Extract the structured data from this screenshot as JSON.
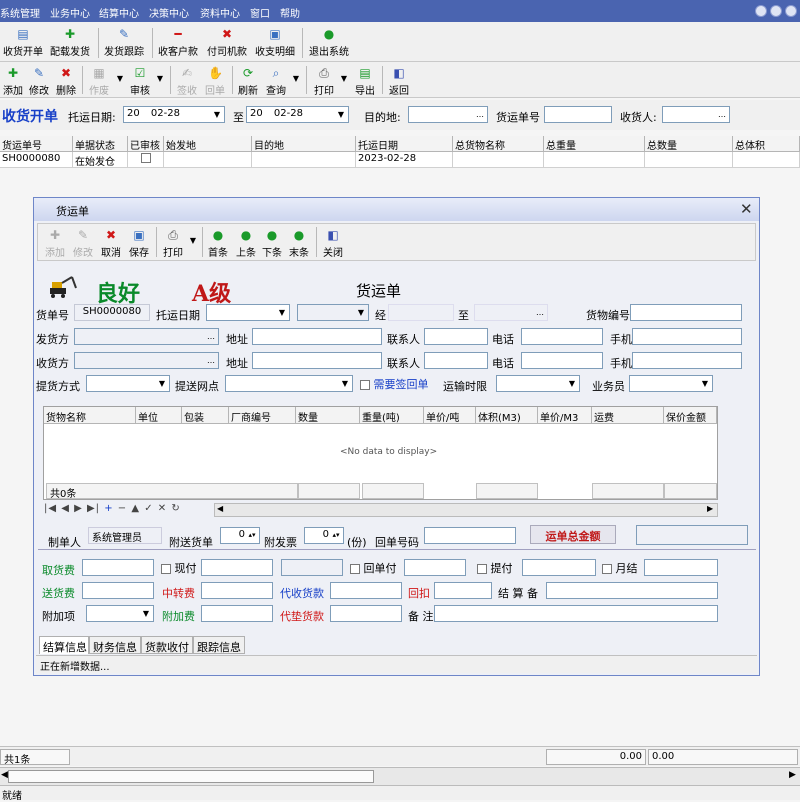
{
  "menu": {
    "items": [
      "系统管理",
      "业务中心",
      "结算中心",
      "决策中心",
      "资料中心",
      "窗口",
      "帮助"
    ]
  },
  "toolbar1": {
    "buttons": [
      "收货开单",
      "配载发货",
      "发货跟踪",
      "收客户款",
      "付司机款",
      "收支明细",
      "退出系统"
    ]
  },
  "toolbar2": {
    "buttons": [
      "添加",
      "修改",
      "删除",
      "作废",
      "审核",
      "签收",
      "回单",
      "刷新",
      "查询",
      "打印",
      "导出",
      "返回"
    ]
  },
  "filter": {
    "title": "收货开单",
    "date_label": "托运日期:",
    "date_from": "20",
    "date_from_rest": "02-28",
    "to_label": "至",
    "date_to": "20",
    "date_to_rest": "02-28",
    "dest_label": "目的地:",
    "dest_value": "",
    "waybill_label": "货运单号",
    "waybill_value": "",
    "receiver_label": "收货人:",
    "receiver_value": ""
  },
  "grid": {
    "headers": [
      "货运单号",
      "单据状态",
      "已审核",
      "始发地",
      "目的地",
      "托运日期",
      "总货物名称",
      "总重量",
      "总数量",
      "总体积"
    ],
    "rows": [
      {
        "waybill": "SH0000080",
        "status": "在始发仓",
        "origin": "",
        "dest": "",
        "date": "2023-02-28",
        "goods": "",
        "weight": "",
        "qty": "",
        "volume": ""
      }
    ]
  },
  "dialog": {
    "title": "货运单",
    "toolbar": [
      "添加",
      "修改",
      "取消",
      "保存",
      "打印",
      "首条",
      "上条",
      "下条",
      "末条",
      "关闭"
    ],
    "badge_good": "良好",
    "badge_level": "A级",
    "form_title": "货运单",
    "waybill_label": "货单号",
    "waybill_value": "SH0000080",
    "date_label": "托运日期",
    "date_value": "",
    "via_label": "经",
    "to_label": "至",
    "goods_no_label": "货物编号",
    "sender_label": "发货方",
    "addr_label": "地址",
    "contact_label": "联系人",
    "phone_label": "电话",
    "mobile_label": "手机",
    "receiver_label": "收货方",
    "pickup_label": "提货方式",
    "delivery_point_label": "提送网点",
    "need_receipt_label": "需要签回单",
    "transport_limit_label": "运输时限",
    "salesman_label": "业务员",
    "goods_grid": {
      "headers": [
        "货物名称",
        "单位",
        "包装",
        "厂商编号",
        "数量",
        "重量(吨)",
        "单价/吨",
        "体积(M3)",
        "单价/M3",
        "运费",
        "保价金额"
      ],
      "empty_text": "<No data to display>",
      "footer_count": "共0条"
    },
    "maker_label": "制单人",
    "maker_value": "系统管理员",
    "attach_label": "附送货单",
    "attach_value": "0",
    "invoice_label": "附发票",
    "invoice_value": "0",
    "copies_label": "(份)",
    "receipt_no_label": "回单号码",
    "total_button": "运单总金额",
    "fees": {
      "pickup_fee": "取货费",
      "cash_pay": "现付",
      "receipt_pay": "回单付",
      "pickup_pay": "提付",
      "monthly": "月结",
      "delivery_fee": "送货费",
      "transfer_fee": "中转费",
      "cod": "代收货款",
      "rebate": "回扣",
      "settle_note": "结 算 备 注",
      "extra_item": "附加项",
      "extra_fee": "附加费",
      "advance": "代垫货款",
      "remark": "备 注"
    },
    "tabs": [
      "结算信息",
      "财务信息",
      "货款收付",
      "跟踪信息"
    ],
    "status_text": "正在新增数据..."
  },
  "statusbar": {
    "count": "共1条",
    "sum1": "0.00",
    "sum2": "0.00"
  },
  "bottombar": {
    "text": "就绪"
  },
  "colors": {
    "menubar": "#4a64b0",
    "accent_green": "#0a8a2a",
    "accent_red": "#d01818",
    "accent_blue": "#1840c8"
  }
}
